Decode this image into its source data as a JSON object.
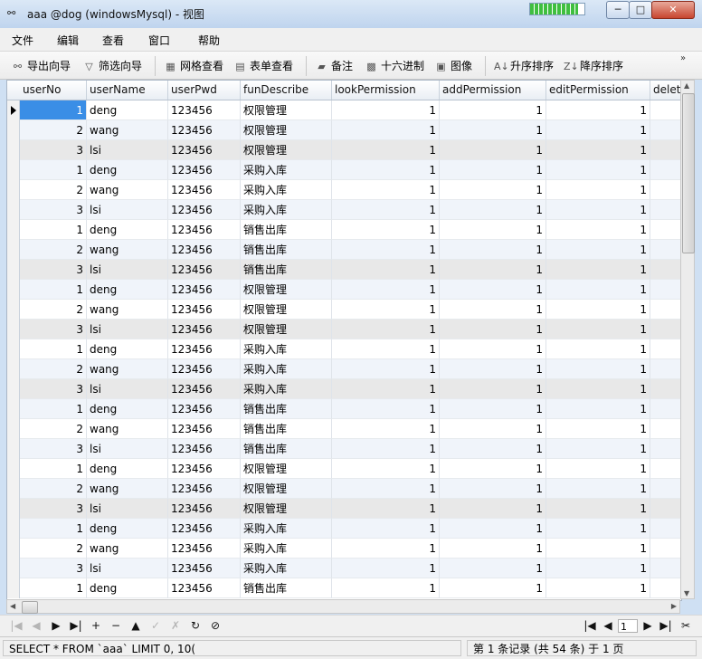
{
  "window": {
    "title": "aaa @dog (windowsMysql) - 视图",
    "title_icon": "glasses-icon",
    "minimize_label": "─",
    "maximize_label": "□",
    "close_label": "✕"
  },
  "menu": [
    "文件",
    "编辑",
    "查看",
    "窗口",
    "帮助"
  ],
  "toolbar": [
    {
      "label": "导出向导",
      "icon": "export-wizard-icon",
      "glyph": "⚯"
    },
    {
      "label": "筛选向导",
      "icon": "filter-icon",
      "glyph": "▽"
    },
    {
      "label": "网格查看",
      "icon": "grid-view-icon",
      "glyph": "▦"
    },
    {
      "label": "表单查看",
      "icon": "form-view-icon",
      "glyph": "▤"
    },
    {
      "label": "备注",
      "icon": "memo-icon",
      "glyph": "▰"
    },
    {
      "label": "十六进制",
      "icon": "hex-icon",
      "glyph": "▩"
    },
    {
      "label": "图像",
      "icon": "image-icon",
      "glyph": "▣"
    },
    {
      "label": "升序排序",
      "icon": "sort-ascending-icon",
      "glyph": "A↓"
    },
    {
      "label": "降序排序",
      "icon": "sort-descending-icon",
      "glyph": "Z↓"
    }
  ],
  "toolbar_more": "»",
  "columns": [
    "userNo",
    "userName",
    "userPwd",
    "funDescribe",
    "lookPermission",
    "addPermission",
    "editPermission",
    "delet"
  ],
  "rows": [
    [
      "1",
      "deng",
      "123456",
      "权限管理",
      "1",
      "1",
      "1"
    ],
    [
      "2",
      "wang",
      "123456",
      "权限管理",
      "1",
      "1",
      "1"
    ],
    [
      "3",
      "lsi",
      "123456",
      "权限管理",
      "1",
      "1",
      "1"
    ],
    [
      "1",
      "deng",
      "123456",
      "采购入库",
      "1",
      "1",
      "1"
    ],
    [
      "2",
      "wang",
      "123456",
      "采购入库",
      "1",
      "1",
      "1"
    ],
    [
      "3",
      "lsi",
      "123456",
      "采购入库",
      "1",
      "1",
      "1"
    ],
    [
      "1",
      "deng",
      "123456",
      "销售出库",
      "1",
      "1",
      "1"
    ],
    [
      "2",
      "wang",
      "123456",
      "销售出库",
      "1",
      "1",
      "1"
    ],
    [
      "3",
      "lsi",
      "123456",
      "销售出库",
      "1",
      "1",
      "1"
    ],
    [
      "1",
      "deng",
      "123456",
      "权限管理",
      "1",
      "1",
      "1"
    ],
    [
      "2",
      "wang",
      "123456",
      "权限管理",
      "1",
      "1",
      "1"
    ],
    [
      "3",
      "lsi",
      "123456",
      "权限管理",
      "1",
      "1",
      "1"
    ],
    [
      "1",
      "deng",
      "123456",
      "采购入库",
      "1",
      "1",
      "1"
    ],
    [
      "2",
      "wang",
      "123456",
      "采购入库",
      "1",
      "1",
      "1"
    ],
    [
      "3",
      "lsi",
      "123456",
      "采购入库",
      "1",
      "1",
      "1"
    ],
    [
      "1",
      "deng",
      "123456",
      "销售出库",
      "1",
      "1",
      "1"
    ],
    [
      "2",
      "wang",
      "123456",
      "销售出库",
      "1",
      "1",
      "1"
    ],
    [
      "3",
      "lsi",
      "123456",
      "销售出库",
      "1",
      "1",
      "1"
    ],
    [
      "1",
      "deng",
      "123456",
      "权限管理",
      "1",
      "1",
      "1"
    ],
    [
      "2",
      "wang",
      "123456",
      "权限管理",
      "1",
      "1",
      "1"
    ],
    [
      "3",
      "lsi",
      "123456",
      "权限管理",
      "1",
      "1",
      "1"
    ],
    [
      "1",
      "deng",
      "123456",
      "采购入库",
      "1",
      "1",
      "1"
    ],
    [
      "2",
      "wang",
      "123456",
      "采购入库",
      "1",
      "1",
      "1"
    ],
    [
      "3",
      "lsi",
      "123456",
      "采购入库",
      "1",
      "1",
      "1"
    ],
    [
      "1",
      "deng",
      "123456",
      "销售出库",
      "1",
      "1",
      "1"
    ]
  ],
  "selected_row": 0,
  "highlighted_rows": [
    2,
    8,
    11,
    14,
    20
  ],
  "nav": {
    "page": "1",
    "buttons_left": [
      {
        "glyph": "|◀",
        "icon": "first-record-icon",
        "enabled": false
      },
      {
        "glyph": "◀",
        "icon": "prev-record-icon",
        "enabled": false
      },
      {
        "glyph": "▶",
        "icon": "next-record-icon",
        "enabled": true
      },
      {
        "glyph": "▶|",
        "icon": "last-record-icon",
        "enabled": true
      },
      {
        "glyph": "+",
        "icon": "add-record-icon",
        "enabled": true
      },
      {
        "glyph": "−",
        "icon": "delete-record-icon",
        "enabled": true
      },
      {
        "glyph": "▲",
        "icon": "apply-icon",
        "enabled": true
      },
      {
        "glyph": "✓",
        "icon": "commit-icon",
        "enabled": false
      },
      {
        "glyph": "✗",
        "icon": "discard-icon",
        "enabled": false
      },
      {
        "glyph": "↻",
        "icon": "refresh-icon",
        "enabled": true
      },
      {
        "glyph": "⊘",
        "icon": "stop-icon",
        "enabled": true
      }
    ],
    "buttons_right": [
      {
        "glyph": "|◀",
        "icon": "first-page-icon"
      },
      {
        "glyph": "◀",
        "icon": "prev-page-icon"
      },
      {
        "glyph": "▶",
        "icon": "next-page-icon"
      },
      {
        "glyph": "▶|",
        "icon": "last-page-icon"
      },
      {
        "glyph": "✂",
        "icon": "settings-icon"
      }
    ]
  },
  "status": {
    "query": "SELECT * FROM `aaa` LIMIT 0, 10(",
    "record_info": "第 1 条记录 (共 54 条) 于 1 页"
  },
  "colors": {
    "selection": "#3a8ee6",
    "titlebar": "#bfd4ee",
    "row_alt": "#f0f4fa"
  }
}
